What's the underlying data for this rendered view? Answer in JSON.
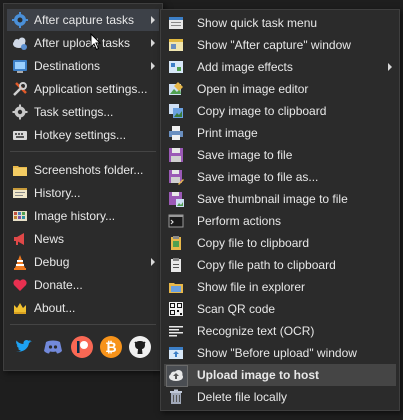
{
  "main_menu": {
    "items": [
      {
        "label": "After capture tasks",
        "icon": "gear-blue-icon",
        "submenu": true
      },
      {
        "label": "After upload tasks",
        "icon": "cloud-gear-icon",
        "submenu": true
      },
      {
        "label": "Destinations",
        "icon": "globe-icon",
        "submenu": true
      },
      {
        "label": "Application settings...",
        "icon": "wrench-icon",
        "submenu": false
      },
      {
        "label": "Task settings...",
        "icon": "gear-icon",
        "submenu": false
      },
      {
        "label": "Hotkey settings...",
        "icon": "keyboard-icon",
        "submenu": false
      },
      {
        "label": "Screenshots folder...",
        "icon": "folder-icon",
        "submenu": false
      },
      {
        "label": "History...",
        "icon": "history-icon",
        "submenu": false
      },
      {
        "label": "Image history...",
        "icon": "image-history-icon",
        "submenu": false
      },
      {
        "label": "News",
        "icon": "megaphone-icon",
        "submenu": false
      },
      {
        "label": "Debug",
        "icon": "traffic-cone-icon",
        "submenu": true
      },
      {
        "label": "Donate...",
        "icon": "heart-icon",
        "submenu": false
      },
      {
        "label": "About...",
        "icon": "crown-icon",
        "submenu": false
      }
    ],
    "social": [
      "twitter-icon",
      "discord-icon",
      "patreon-icon",
      "bitcoin-icon",
      "github-icon"
    ]
  },
  "sub_menu": {
    "items": [
      {
        "label": "Show quick task menu",
        "icon": "quick-task-icon"
      },
      {
        "label": "Show \"After capture\" window",
        "icon": "window-icon"
      },
      {
        "label": "Add image effects",
        "icon": "image-effects-icon",
        "submenu": true
      },
      {
        "label": "Open in image editor",
        "icon": "image-editor-icon"
      },
      {
        "label": "Copy image to clipboard",
        "icon": "copy-image-icon"
      },
      {
        "label": "Print image",
        "icon": "printer-icon"
      },
      {
        "label": "Save image to file",
        "icon": "save-icon"
      },
      {
        "label": "Save image to file as...",
        "icon": "save-as-icon"
      },
      {
        "label": "Save thumbnail image to file",
        "icon": "save-thumbnail-icon"
      },
      {
        "label": "Perform actions",
        "icon": "terminal-icon"
      },
      {
        "label": "Copy file to clipboard",
        "icon": "copy-file-icon"
      },
      {
        "label": "Copy file path to clipboard",
        "icon": "clipboard-icon"
      },
      {
        "label": "Show file in explorer",
        "icon": "folder-explorer-icon"
      },
      {
        "label": "Scan QR code",
        "icon": "qr-code-icon"
      },
      {
        "label": "Recognize text (OCR)",
        "icon": "ocr-icon"
      },
      {
        "label": "Show \"Before upload\" window",
        "icon": "window-upload-icon"
      },
      {
        "label": "Upload image to host",
        "icon": "cloud-upload-icon",
        "checked": true
      },
      {
        "label": "Delete file locally",
        "icon": "trash-icon"
      }
    ]
  }
}
